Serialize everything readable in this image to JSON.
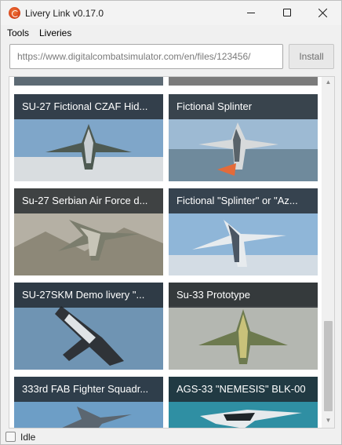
{
  "window": {
    "title": "Livery Link v0.17.0",
    "icons": {
      "app": "app-logo-icon",
      "minimize": "minimize-icon",
      "maximize": "maximize-icon",
      "close": "close-icon"
    }
  },
  "menu": {
    "items": [
      {
        "label": "Tools"
      },
      {
        "label": "Liveries"
      }
    ]
  },
  "url_bar": {
    "placeholder": "https://www.digitalcombatsimulator.com/en/files/123456/",
    "install_label": "Install"
  },
  "liveries": [
    {
      "title": "SU-27 Fictional CZAF Hid...",
      "sky": "#7fa6c9"
    },
    {
      "title": "Fictional Splinter",
      "sky": "#9dbad3"
    },
    {
      "title": "Su-27 Serbian Air Force d...",
      "sky": "#b5b0a4"
    },
    {
      "title": "Fictional \"Splinter\" or \"Az...",
      "sky": "#8fb6d8"
    },
    {
      "title": "SU-27SKM Demo livery \"...",
      "sky": "#6f94b3"
    },
    {
      "title": "Su-33 Prototype",
      "sky": "#8a8d86"
    },
    {
      "title": "333rd FAB Fighter Squadr...",
      "sky": "#6d9ec6"
    },
    {
      "title": "AGS-33 \"NEMESIS\" BLK-00",
      "sky": "#2f8fa3"
    }
  ],
  "status": {
    "text": "Idle"
  },
  "colors": {
    "accent": "#d9471c",
    "label_overlay": "#1e2228"
  }
}
